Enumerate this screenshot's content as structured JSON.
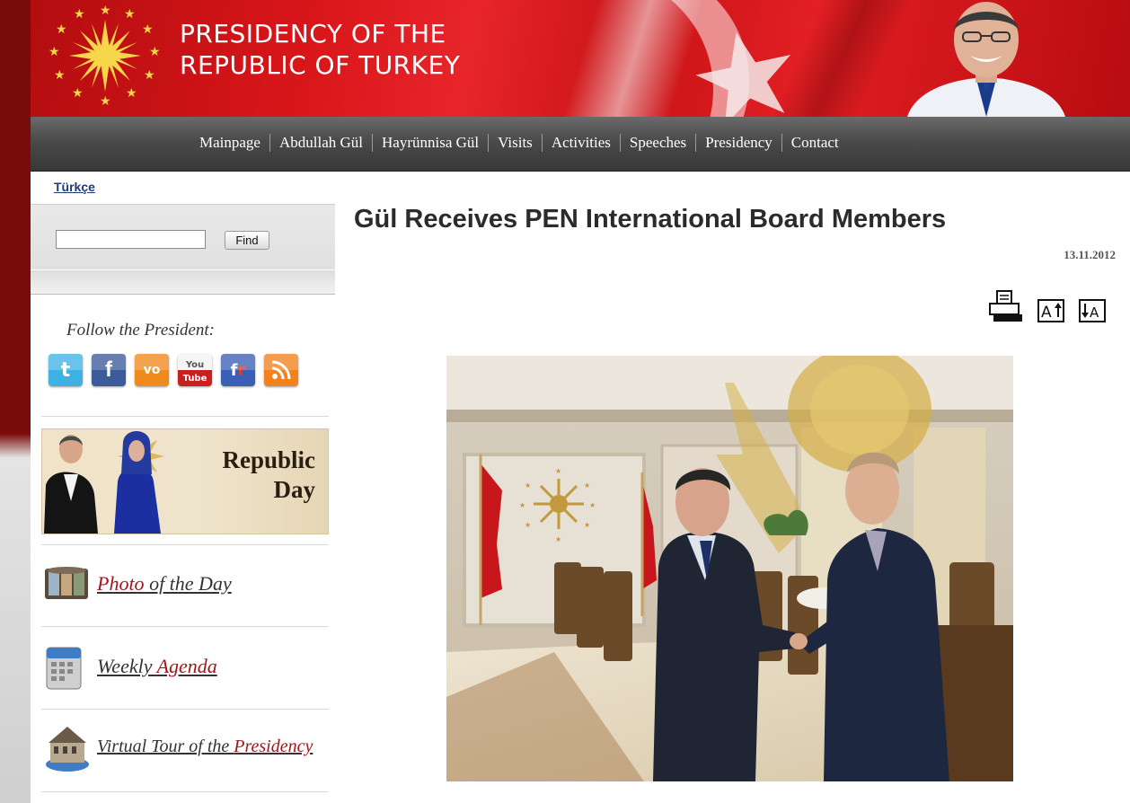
{
  "header": {
    "title_line1": "PRESIDENCY OF THE",
    "title_line2": "REPUBLIC OF TURKEY"
  },
  "nav": {
    "items": [
      {
        "label": "Mainpage"
      },
      {
        "label": "Abdullah Gül"
      },
      {
        "label": "Hayrünnisa Gül"
      },
      {
        "label": "Visits"
      },
      {
        "label": "Activities"
      },
      {
        "label": "Speeches"
      },
      {
        "label": "Presidency"
      },
      {
        "label": "Contact"
      }
    ]
  },
  "sidebar": {
    "language_link": "Türkçe",
    "search": {
      "value": "",
      "button_label": "Find"
    },
    "follow_title": "Follow the President:",
    "social_icons": [
      "twitter-icon",
      "facebook-icon",
      "video-icon",
      "youtube-icon",
      "friendfeed-icon",
      "rss-icon"
    ],
    "republic_day": {
      "line1": "Republic",
      "line2": "Day"
    },
    "photo_of_day": {
      "highlight": "Photo",
      "rest": " of the Day"
    },
    "weekly_agenda": {
      "prefix": "Weekly ",
      "highlight": "Agenda"
    },
    "virtual_tour": {
      "prefix": "Virtual Tour of the ",
      "highlight": "Presidency"
    }
  },
  "article": {
    "title": "Gül Receives PEN International Board Members",
    "date": "13.11.2012",
    "tools": [
      "print-icon",
      "font-increase-icon",
      "font-decrease-icon"
    ]
  },
  "colors": {
    "banner_red": "#d8161a",
    "nav_dark": "#404040",
    "link_red": "#a8131a",
    "lang_blue": "#1a3c78"
  }
}
